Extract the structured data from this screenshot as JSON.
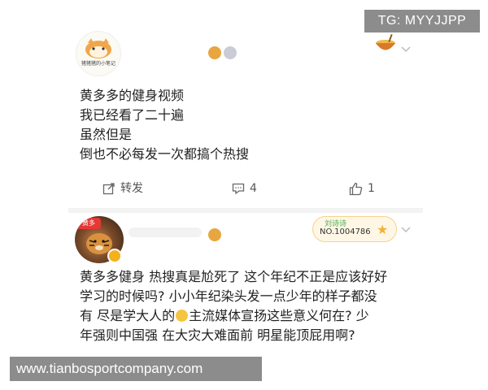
{
  "watermarks": {
    "top_right": "TG: MYYJJPP",
    "bottom_left": "www.tianbosportcompany.com"
  },
  "post1": {
    "avatar_caption": "猪猪猪的小笔记",
    "lines": [
      "黄多多的健身视频",
      "我已经看了二十遍",
      "虽然但是",
      "倒也不必每发一次都搞个热搜"
    ],
    "actions": {
      "forward_label": "转发",
      "comment_count": "4",
      "like_count": "1"
    }
  },
  "post2": {
    "avatar_sticker": "黄多",
    "fan_badge": {
      "name": "刘诗诗",
      "number": "NO.1004786"
    },
    "lines": [
      "黄多多健身 热搜真是尬死了 这个年纪不正是应该好好",
      "学习的时候吗? 小小年纪染头发一点少年的样子都没",
      "有 尽是学大人的",
      "年强则中国强 在大灾大难面前 明星能顶屁用啊?"
    ],
    "line3_after_emoji": "主流媒体宣扬这些意义何在? 少"
  },
  "colors": {
    "watermark_bg": "#787878",
    "badge_gold": "#e7a640",
    "fan_badge_bg": "#fff7e6"
  },
  "icons": [
    "bowl-icon",
    "chevron-down-icon",
    "share-icon",
    "comment-icon",
    "thumbs-up-icon",
    "star-icon",
    "verified-icon"
  ]
}
